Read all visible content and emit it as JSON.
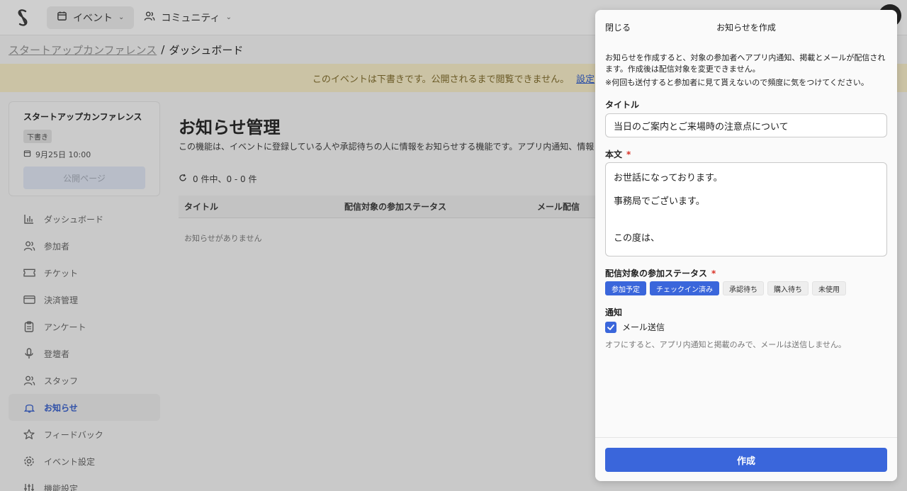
{
  "header": {
    "nav": [
      {
        "label": "イベント",
        "icon": "calendar-icon"
      },
      {
        "label": "コミュニティ",
        "icon": "users-icon"
      }
    ]
  },
  "breadcrumb": {
    "parent": "スタートアップカンファレンス",
    "separator": "/",
    "current": "ダッシュボード"
  },
  "banner": {
    "text": "このイベントは下書きです。公開されるまで閲覧できません。",
    "link": "設定"
  },
  "event": {
    "name": "スタートアップカンファレンス",
    "status": "下書き",
    "date": "9月25日 10:00",
    "public_page_button": "公開ページ"
  },
  "sidebar": {
    "items": [
      {
        "label": "ダッシュボード",
        "icon": "bar-chart-icon"
      },
      {
        "label": "参加者",
        "icon": "users-icon"
      },
      {
        "label": "チケット",
        "icon": "ticket-icon"
      },
      {
        "label": "決済管理",
        "icon": "credit-card-icon"
      },
      {
        "label": "アンケート",
        "icon": "clipboard-icon"
      },
      {
        "label": "登壇者",
        "icon": "microphone-icon"
      },
      {
        "label": "スタッフ",
        "icon": "staff-icon"
      },
      {
        "label": "お知らせ",
        "icon": "bell-icon"
      },
      {
        "label": "フィードバック",
        "icon": "star-icon"
      },
      {
        "label": "イベント設定",
        "icon": "gear-icon"
      },
      {
        "label": "機能設定",
        "icon": "sliders-icon"
      }
    ]
  },
  "main": {
    "title": "お知らせ管理",
    "description": "この機能は、イベントに登録している人や承認待ちの人に情報をお知らせする機能です。アプリ内通知、情報",
    "count": "0 件中、0 - 0 件",
    "columns": [
      "タイトル",
      "配信対象の参加ステータス",
      "メール配信"
    ],
    "empty": "お知らせがありません"
  },
  "modal": {
    "close": "閉じる",
    "title": "お知らせを作成",
    "notice": "お知らせを作成すると、対象の参加者へアプリ内通知、掲載とメールが配信されます。作成後は配信対象を変更できません。",
    "warning": "※何回も送付すると参加者に見て貰えないので頻度に気をつけてください。",
    "title_label": "タイトル",
    "title_value": "当日のご案内とご来場時の注意点について",
    "body_label": "本文",
    "required_mark": "*",
    "body_lines": [
      "お世話になっております。",
      "事務局でございます。",
      "",
      "この度は、"
    ],
    "status_label": "配信対象の参加ステータス",
    "statuses": [
      {
        "label": "参加予定",
        "selected": true
      },
      {
        "label": "チェックイン済み",
        "selected": true
      },
      {
        "label": "承認待ち",
        "selected": false
      },
      {
        "label": "購入待ち",
        "selected": false
      },
      {
        "label": "未使用",
        "selected": false
      }
    ],
    "notify_label": "通知",
    "email_checkbox": "メール送信",
    "email_checked": true,
    "hint": "オフにすると、アプリ内通知と掲載のみで、メールは送信しません。",
    "create_button": "作成"
  },
  "colors": {
    "accent": "#3a66db",
    "required": "#d93025",
    "banner_bg": "#cbc3a5"
  }
}
